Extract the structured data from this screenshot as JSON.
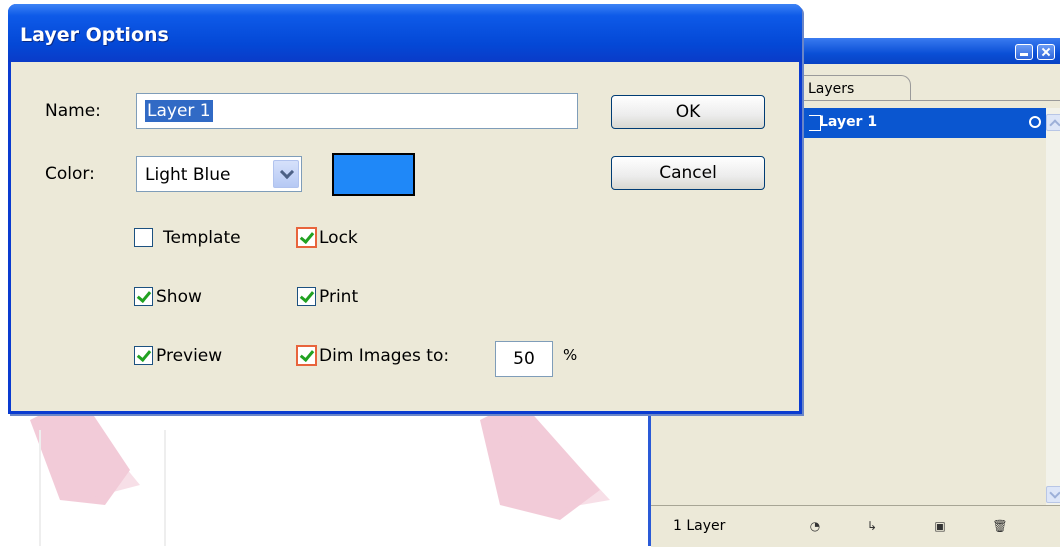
{
  "dialog": {
    "title": "Layer Options",
    "name_label": "Name:",
    "name_value": "Layer 1",
    "color_label": "Color:",
    "color_value": "Light Blue",
    "swatch_color": "#1f88f8",
    "ok_label": "OK",
    "cancel_label": "Cancel",
    "options": {
      "template": {
        "label": "Template",
        "checked": false
      },
      "lock": {
        "label": "Lock",
        "checked": true
      },
      "show": {
        "label": "Show",
        "checked": true
      },
      "print": {
        "label": "Print",
        "checked": true
      },
      "preview": {
        "label": "Preview",
        "checked": true
      },
      "dim": {
        "label": "Dim Images to:",
        "checked": true,
        "value": "50",
        "unit": "%"
      }
    }
  },
  "layers_panel": {
    "tab_label": "Layers",
    "layers": [
      {
        "name": "Layer 1",
        "selected": true
      }
    ],
    "footer_count": "1 Layer",
    "footer_icons": [
      "make-clipping-mask-icon",
      "create-sublayer-icon",
      "new-layer-icon",
      "trash-icon"
    ]
  },
  "colors": {
    "titlebar": "#0448d6",
    "selection": "#0a56d0",
    "dialog_bg": "#ece9d8"
  }
}
